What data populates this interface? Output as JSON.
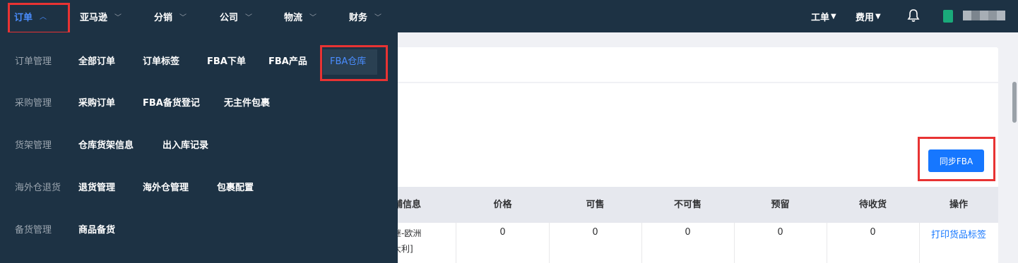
{
  "top_nav": {
    "items": [
      {
        "label": "订单"
      },
      {
        "label": "亚马逊"
      },
      {
        "label": "分销"
      },
      {
        "label": "公司"
      },
      {
        "label": "物流"
      },
      {
        "label": "财务"
      }
    ],
    "right": {
      "ticket": "工单",
      "fee": "费用"
    }
  },
  "menu": {
    "rows": [
      {
        "category": "订单管理",
        "links": [
          "全部订单",
          "订单标签",
          "FBA下单",
          "FBA产品",
          "FBA仓库"
        ]
      },
      {
        "category": "采购管理",
        "links": [
          "采购订单",
          "FBA备货登记",
          "无主件包裹"
        ]
      },
      {
        "category": "货架管理",
        "links": [
          "仓库货架信息",
          "出入库记录"
        ]
      },
      {
        "category": "海外仓退货",
        "links": [
          "退货管理",
          "海外仓管理",
          "包裹配置"
        ]
      },
      {
        "category": "备货管理",
        "links": [
          "商品备货"
        ]
      }
    ]
  },
  "content": {
    "sync_button": "同步FBA",
    "table": {
      "headers": [
        "店铺信息",
        "价格",
        "可售",
        "不可售",
        "预留",
        "待收货",
        "操作"
      ],
      "row": {
        "store_line1": "晋继-欧洲",
        "store_line2": "意大利]",
        "price": "0",
        "sellable": "0",
        "unsellable": "0",
        "reserved": "0",
        "pending": "0",
        "action": "打印货品标签"
      }
    }
  },
  "colors": {
    "nav_bg": "#1d3244",
    "accent": "#1677ff",
    "active_nav": "#4a8dff",
    "annotation": "#e83333"
  },
  "icons": [
    "chevron-down-icon",
    "chevron-up-icon",
    "bell-icon",
    "caret-down-icon"
  ]
}
